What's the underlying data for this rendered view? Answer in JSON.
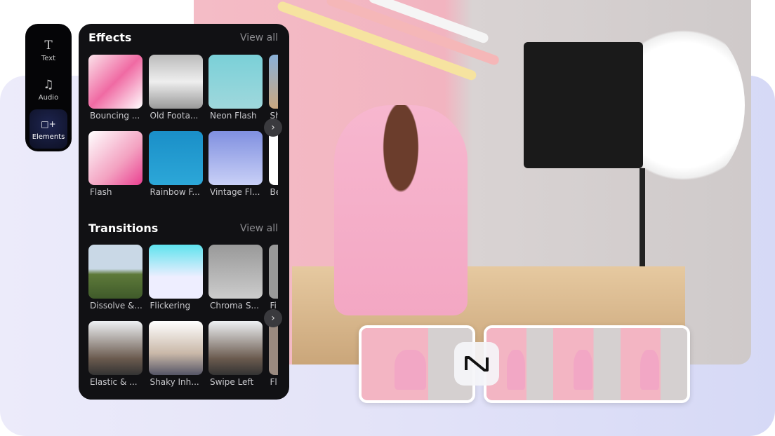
{
  "rail": {
    "items": [
      {
        "label": "Text",
        "icon": "text-icon"
      },
      {
        "label": "Audio",
        "icon": "music-note-icon"
      },
      {
        "label": "Elements",
        "icon": "elements-icon",
        "active": true
      }
    ]
  },
  "effects": {
    "title": "Effects",
    "view_all": "View all",
    "items": [
      "Bouncing ...",
      "Old Foota...",
      "Neon Flash",
      "Sh",
      "Flash",
      "Rainbow F...",
      "Vintage Fl...",
      "Be"
    ]
  },
  "transitions": {
    "title": "Transitions",
    "view_all": "View all",
    "items": [
      "Dissolve &...",
      "Flickering",
      "Chroma S...",
      "Fi",
      "Elastic & ...",
      "Shaky Inh...",
      "Swipe Left",
      "Fl"
    ]
  },
  "timeline": {
    "transition_icon": "transition-icon"
  }
}
